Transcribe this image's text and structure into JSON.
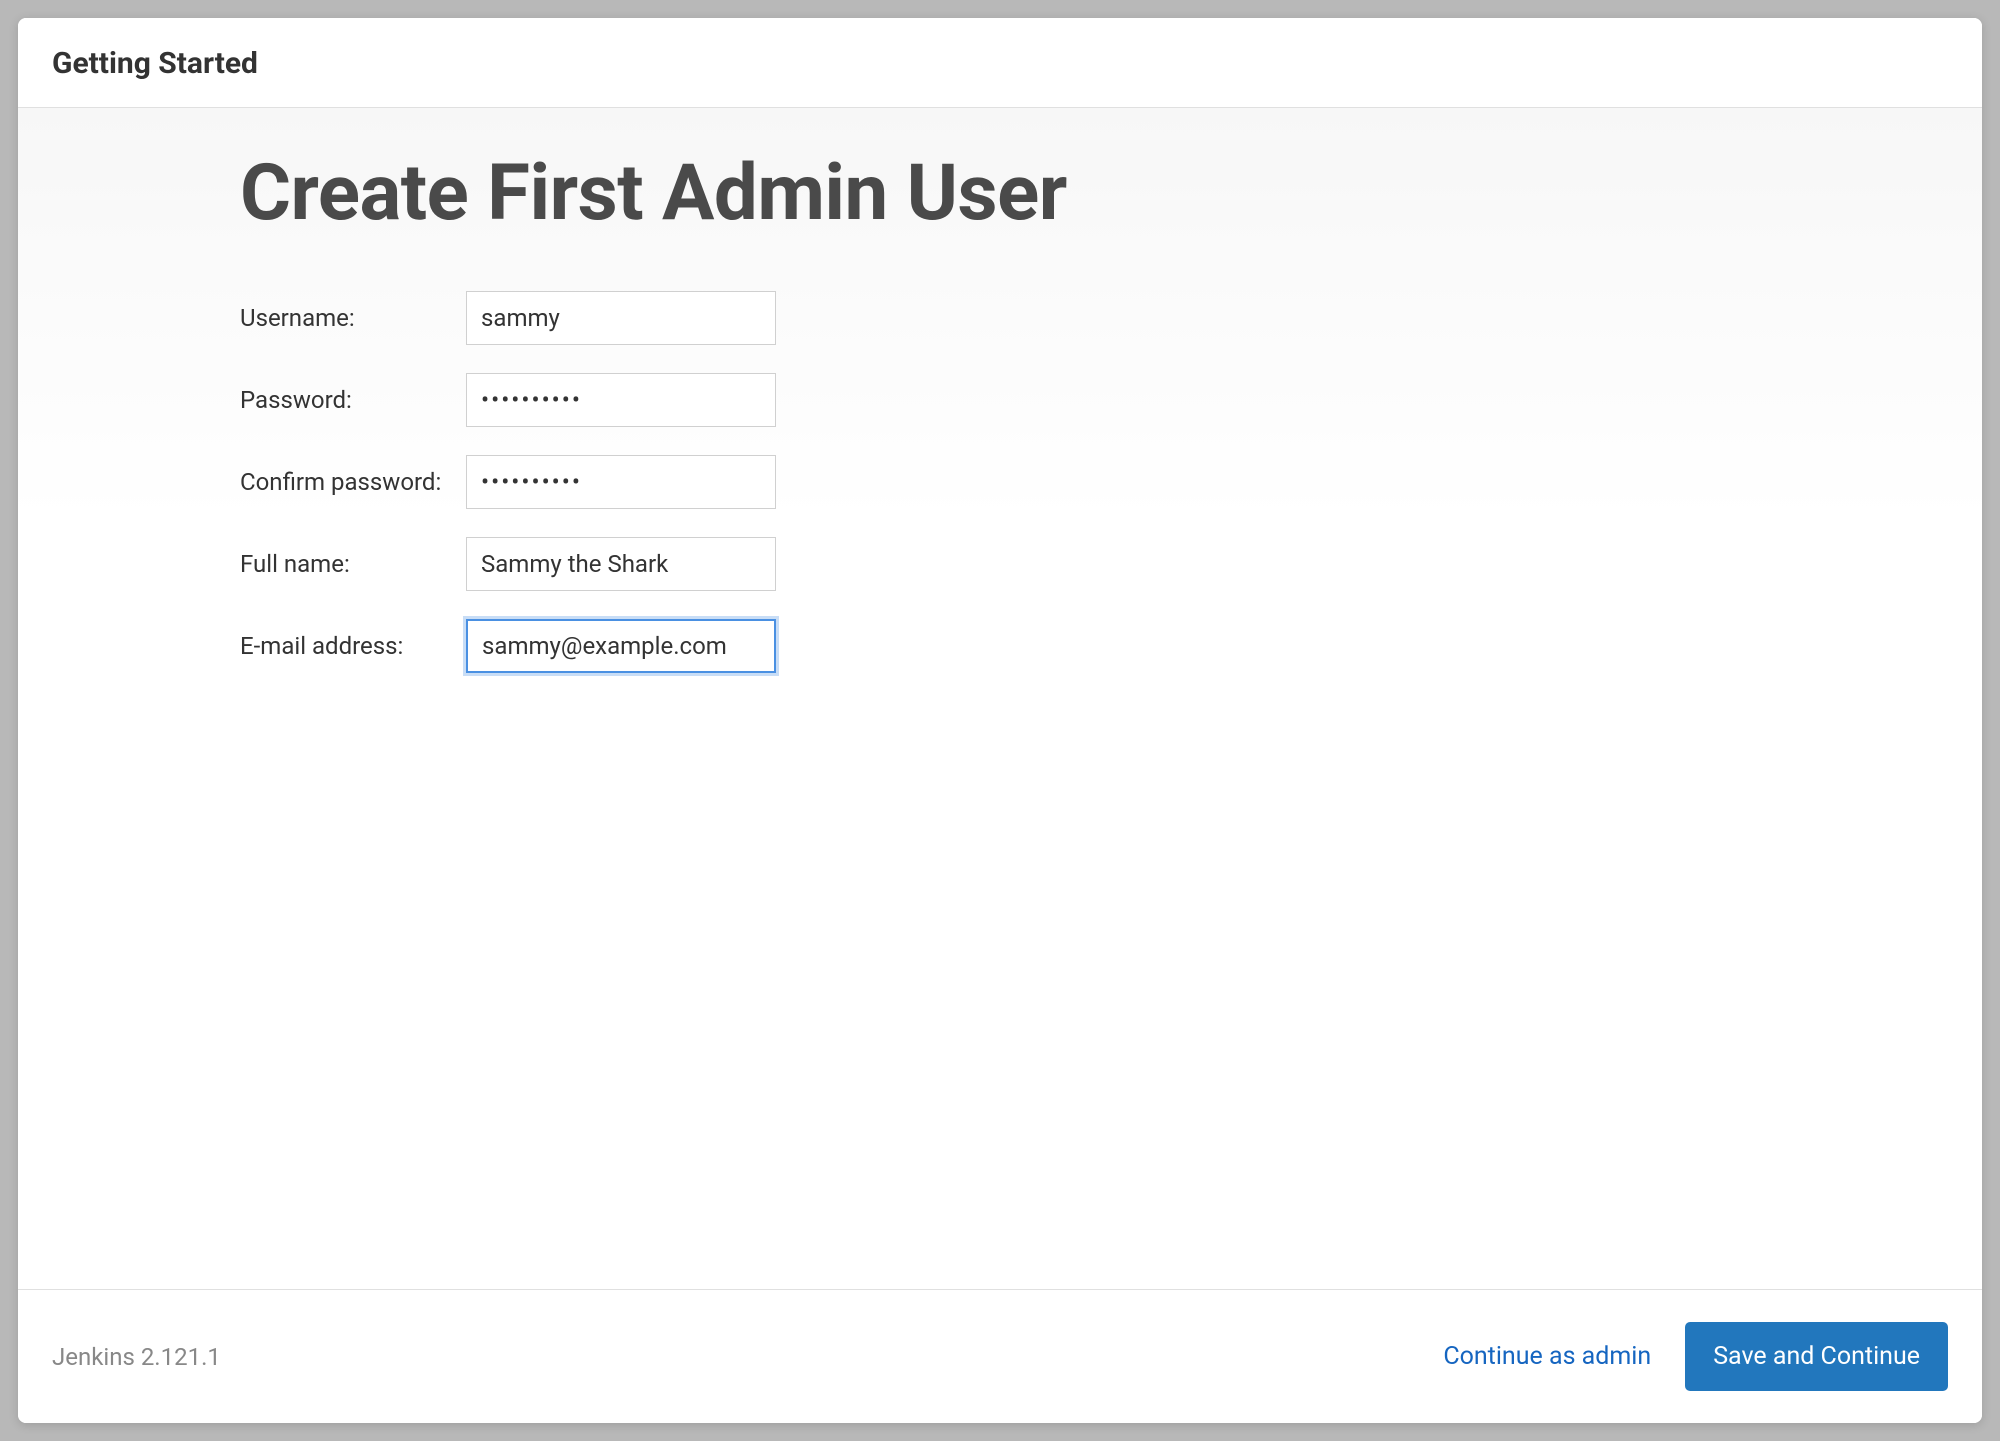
{
  "header": {
    "title": "Getting Started"
  },
  "main": {
    "page_title": "Create First Admin User",
    "form": {
      "username": {
        "label": "Username:",
        "value": "sammy"
      },
      "password": {
        "label": "Password:",
        "value": "••••••••••"
      },
      "confirm_password": {
        "label": "Confirm password:",
        "value": "••••••••••"
      },
      "fullname": {
        "label": "Full name:",
        "value": "Sammy the Shark"
      },
      "email": {
        "label": "E-mail address:",
        "value": "sammy@example.com"
      }
    }
  },
  "footer": {
    "version": "Jenkins 2.121.1",
    "continue_as_admin_label": "Continue as admin",
    "save_continue_label": "Save and Continue"
  }
}
